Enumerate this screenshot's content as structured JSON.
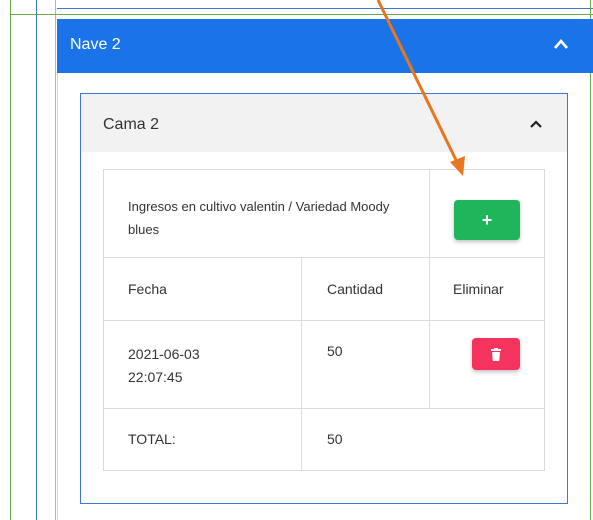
{
  "nave": {
    "title": "Nave 2",
    "chevron_icon": "chevron-up-icon",
    "color": "#1a73e8"
  },
  "cama": {
    "title": "Cama 2",
    "chevron_icon": "chevron-up-icon"
  },
  "card": {
    "description": "Ingresos en cultivo valentin / Variedad Moody blues",
    "add_button_label": "+",
    "add_button_color": "#1fb55a"
  },
  "table": {
    "headers": [
      "Fecha",
      "Cantidad",
      "Eliminar"
    ],
    "rows": [
      {
        "fecha": "2021-06-03 22:07:45",
        "fecha_date": "2021-06-03",
        "fecha_time": "22:07:45",
        "cantidad": "50",
        "delete_icon": "trash-icon",
        "delete_color": "#f4345c"
      }
    ],
    "total_label": "TOTAL:",
    "total_value": "50"
  },
  "annotation": {
    "arrow_color": "#e8761f"
  }
}
